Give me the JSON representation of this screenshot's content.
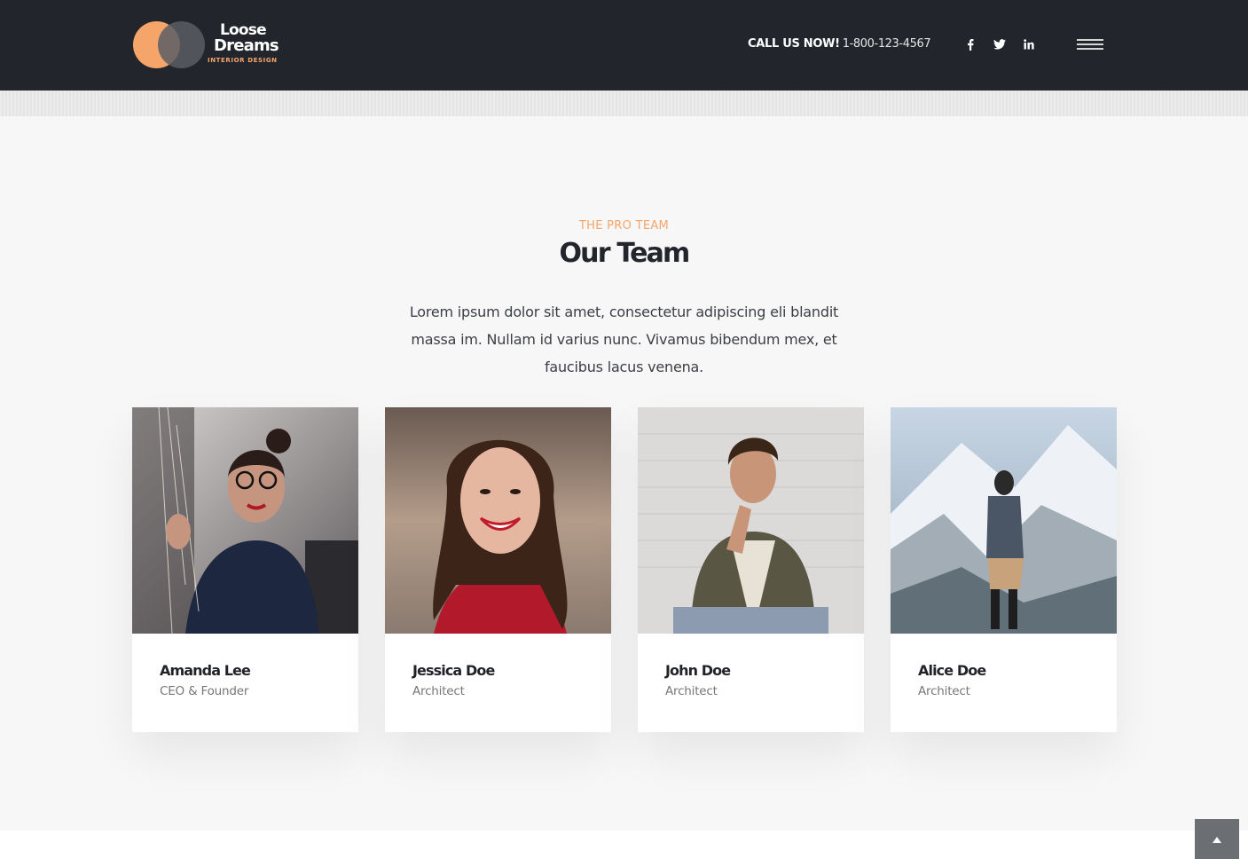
{
  "brand": {
    "line1": "Loose",
    "line2": "Dreams",
    "tagline": "INTERIOR DESIGN",
    "accent_color": "#f5a56a"
  },
  "header": {
    "call_label": "CALL US NOW!",
    "phone": "1-800-123-4567",
    "social": {
      "facebook": "f",
      "twitter": "🐦",
      "linkedin": "in"
    },
    "menu_icon": "hamburger-icon"
  },
  "team_section": {
    "eyebrow": "THE PRO TEAM",
    "title": "Our Team",
    "lead": "Lorem ipsum dolor sit amet, consectetur adipiscing eli blandit massa im. Nullam id varius nunc. Vivamus bibendum mex, et faucibus lacus venena.",
    "members": [
      {
        "name": "Amanda Lee",
        "role": "CEO & Founder"
      },
      {
        "name": "Jessica Doe",
        "role": "Architect"
      },
      {
        "name": "John Doe",
        "role": "Architect"
      },
      {
        "name": "Alice Doe",
        "role": "Architect"
      }
    ]
  },
  "scroll_top_icon": "chevron-up-icon"
}
